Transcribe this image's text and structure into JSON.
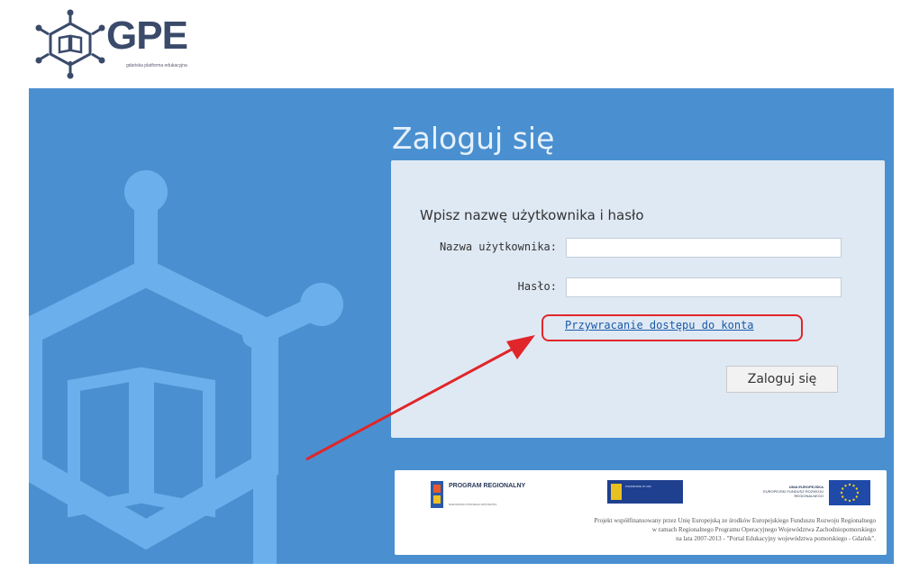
{
  "header": {
    "logo_text": "GPE",
    "logo_subtitle": "gdańska platforma edukacyjna"
  },
  "login": {
    "title": "Zaloguj się",
    "heading": "Wpisz nazwę użytkownika i hasło",
    "username_label": "Nazwa użytkownika:",
    "username_value": "",
    "password_label": "Hasło:",
    "password_value": "",
    "recover_link": "Przywracanie dostępu do konta",
    "submit_label": "Zaloguj się"
  },
  "banner": {
    "program_title": "PROGRAM REGIONALNY",
    "program_subtitle": "NARODOWA STRATEGIA SPÓJNOŚCI",
    "pomorskie_text": "POMORSKIE W UNII",
    "eu_title": "UNIA EUROPEJSKA",
    "eu_subtitle": "EUROPEJSKI FUNDUSZ ROZWOJU REGIONALNEGO",
    "funding_line_1": "Projekt współfinansowany przez Unię Europejską ze środków Europejskiego Funduszu Rozwoju Regionalnego",
    "funding_line_2": "w ramach Regionalnego Programu Operacyjnego Województwa Zachodniopomorskiego",
    "funding_line_3": "na lata 2007-2013 - \"Portal Edukacyjny województwa pomorskiego - Gdańsk\"."
  },
  "colors": {
    "main_background": "#4a90d0",
    "panel_background": "#dfe9f4",
    "highlight_red": "#e0262a",
    "link_blue": "#1a5aa8"
  },
  "icons": {
    "logo": "hexagon-book-logo-icon",
    "background_graphic": "hexagon-book-graphic-icon",
    "annotation": "red-arrow-icon"
  }
}
